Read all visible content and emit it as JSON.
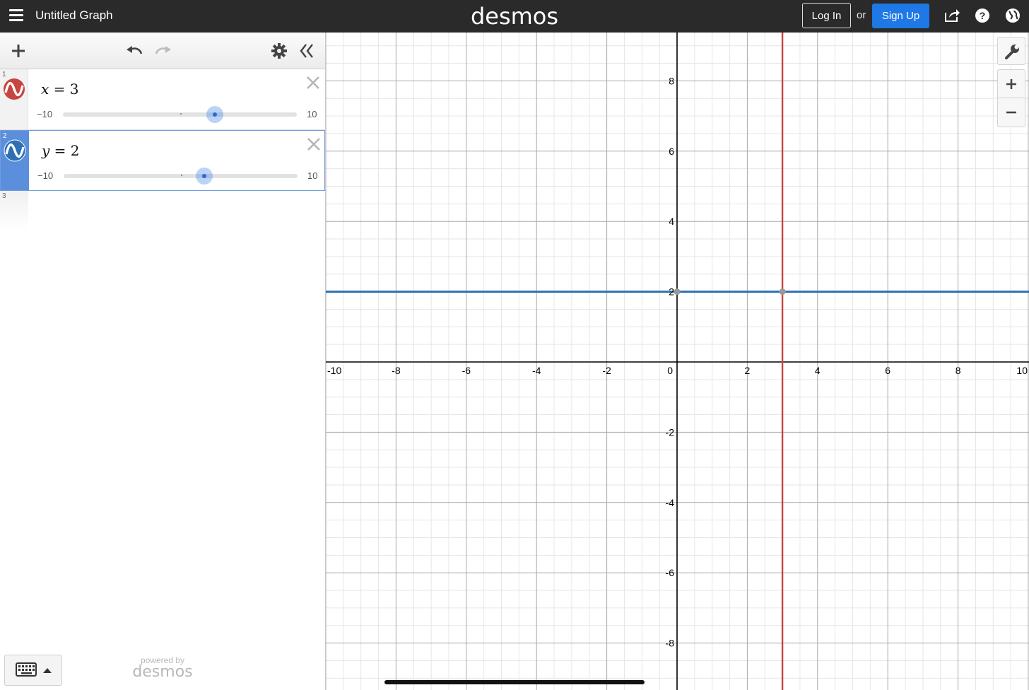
{
  "header": {
    "graph_title": "Untitled Graph",
    "brand": "desmos",
    "login_label": "Log In",
    "or_text": "or",
    "signup_label": "Sign Up",
    "signup_color": "#1e78e6"
  },
  "toolbar": {
    "icons": [
      "plus-icon",
      "undo-icon",
      "redo-icon",
      "gear-icon",
      "collapse-panel-icon"
    ]
  },
  "expressions": [
    {
      "index": "1",
      "var": "x",
      "eq": " = ",
      "value": "3",
      "slider_min": "−10",
      "slider_max": "10",
      "slider_value": 3,
      "color": "#c74440"
    },
    {
      "index": "2",
      "var": "y",
      "eq": " = ",
      "value": "2",
      "slider_min": "−10",
      "slider_max": "10",
      "slider_value": 2,
      "color": "#2d70b3"
    }
  ],
  "empty_row": {
    "index": "3"
  },
  "footer": {
    "powered_by": "powered by",
    "powered_logo": "desmos"
  },
  "graph": {
    "x_range": [
      -10,
      10
    ],
    "y_range": [
      -9.2,
      9.2
    ],
    "x_ticks": [
      "-10",
      "-8",
      "-6",
      "-4",
      "-2",
      "0",
      "2",
      "4",
      "6",
      "8",
      "10"
    ],
    "y_ticks": [
      "8",
      "6",
      "4",
      "2",
      "-2",
      "-4",
      "-6",
      "-8"
    ],
    "vertical_line": {
      "x": 3,
      "color": "#c74440"
    },
    "horizontal_line": {
      "y": 2,
      "color": "#2d70b3"
    },
    "points_of_interest": [
      [
        0,
        2
      ],
      [
        3,
        2
      ]
    ]
  },
  "side_tools": [
    "wrench-icon",
    "zoom-in-icon",
    "zoom-out-icon"
  ]
}
